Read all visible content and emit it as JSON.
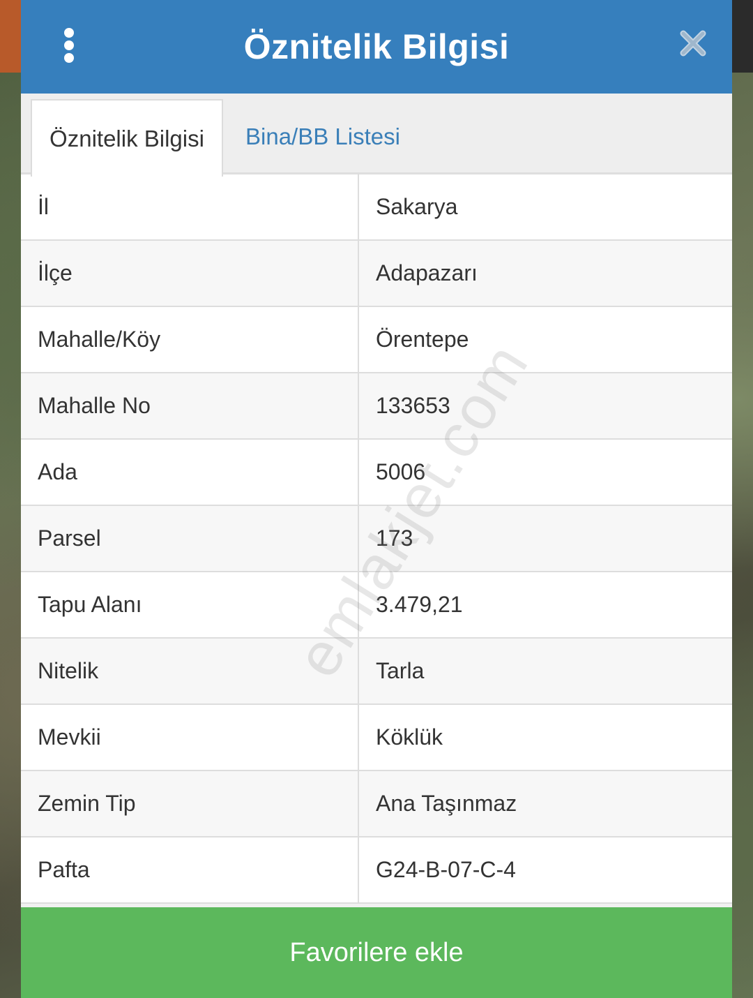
{
  "header": {
    "title": "Öznitelik Bilgisi"
  },
  "tabs": [
    {
      "label": "Öznitelik Bilgisi",
      "active": true
    },
    {
      "label": "Bina/BB Listesi",
      "active": false
    }
  ],
  "rows": [
    {
      "label": "İl",
      "value": "Sakarya"
    },
    {
      "label": "İlçe",
      "value": "Adapazarı"
    },
    {
      "label": "Mahalle/Köy",
      "value": "Örentepe"
    },
    {
      "label": "Mahalle No",
      "value": "133653"
    },
    {
      "label": "Ada",
      "value": "5006"
    },
    {
      "label": "Parsel",
      "value": "173"
    },
    {
      "label": "Tapu Alanı",
      "value": "3.479,21"
    },
    {
      "label": "Nitelik",
      "value": "Tarla"
    },
    {
      "label": "Mevkii",
      "value": "Köklük"
    },
    {
      "label": "Zemin Tip",
      "value": "Ana Taşınmaz"
    },
    {
      "label": "Pafta",
      "value": "G24-B-07-C-4"
    }
  ],
  "watermark": "emlakjet.com",
  "footer": {
    "favorite_label": "Favorilere ekle"
  },
  "colors": {
    "header_bg": "#367fbd",
    "tab_link": "#3a7fb8",
    "favorite_bg": "#5cb85c"
  },
  "icons": {
    "menu": "more-vertical-icon",
    "close": "close-icon"
  }
}
